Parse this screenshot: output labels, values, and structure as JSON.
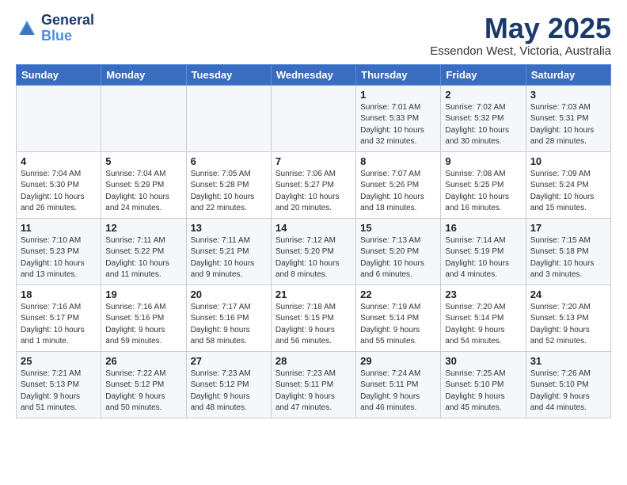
{
  "header": {
    "logo_general": "General",
    "logo_blue": "Blue",
    "month_title": "May 2025",
    "location": "Essendon West, Victoria, Australia"
  },
  "calendar": {
    "days_of_week": [
      "Sunday",
      "Monday",
      "Tuesday",
      "Wednesday",
      "Thursday",
      "Friday",
      "Saturday"
    ],
    "weeks": [
      [
        {
          "day": "",
          "info": ""
        },
        {
          "day": "",
          "info": ""
        },
        {
          "day": "",
          "info": ""
        },
        {
          "day": "",
          "info": ""
        },
        {
          "day": "1",
          "info": "Sunrise: 7:01 AM\nSunset: 5:33 PM\nDaylight: 10 hours\nand 32 minutes."
        },
        {
          "day": "2",
          "info": "Sunrise: 7:02 AM\nSunset: 5:32 PM\nDaylight: 10 hours\nand 30 minutes."
        },
        {
          "day": "3",
          "info": "Sunrise: 7:03 AM\nSunset: 5:31 PM\nDaylight: 10 hours\nand 28 minutes."
        }
      ],
      [
        {
          "day": "4",
          "info": "Sunrise: 7:04 AM\nSunset: 5:30 PM\nDaylight: 10 hours\nand 26 minutes."
        },
        {
          "day": "5",
          "info": "Sunrise: 7:04 AM\nSunset: 5:29 PM\nDaylight: 10 hours\nand 24 minutes."
        },
        {
          "day": "6",
          "info": "Sunrise: 7:05 AM\nSunset: 5:28 PM\nDaylight: 10 hours\nand 22 minutes."
        },
        {
          "day": "7",
          "info": "Sunrise: 7:06 AM\nSunset: 5:27 PM\nDaylight: 10 hours\nand 20 minutes."
        },
        {
          "day": "8",
          "info": "Sunrise: 7:07 AM\nSunset: 5:26 PM\nDaylight: 10 hours\nand 18 minutes."
        },
        {
          "day": "9",
          "info": "Sunrise: 7:08 AM\nSunset: 5:25 PM\nDaylight: 10 hours\nand 16 minutes."
        },
        {
          "day": "10",
          "info": "Sunrise: 7:09 AM\nSunset: 5:24 PM\nDaylight: 10 hours\nand 15 minutes."
        }
      ],
      [
        {
          "day": "11",
          "info": "Sunrise: 7:10 AM\nSunset: 5:23 PM\nDaylight: 10 hours\nand 13 minutes."
        },
        {
          "day": "12",
          "info": "Sunrise: 7:11 AM\nSunset: 5:22 PM\nDaylight: 10 hours\nand 11 minutes."
        },
        {
          "day": "13",
          "info": "Sunrise: 7:11 AM\nSunset: 5:21 PM\nDaylight: 10 hours\nand 9 minutes."
        },
        {
          "day": "14",
          "info": "Sunrise: 7:12 AM\nSunset: 5:20 PM\nDaylight: 10 hours\nand 8 minutes."
        },
        {
          "day": "15",
          "info": "Sunrise: 7:13 AM\nSunset: 5:20 PM\nDaylight: 10 hours\nand 6 minutes."
        },
        {
          "day": "16",
          "info": "Sunrise: 7:14 AM\nSunset: 5:19 PM\nDaylight: 10 hours\nand 4 minutes."
        },
        {
          "day": "17",
          "info": "Sunrise: 7:15 AM\nSunset: 5:18 PM\nDaylight: 10 hours\nand 3 minutes."
        }
      ],
      [
        {
          "day": "18",
          "info": "Sunrise: 7:16 AM\nSunset: 5:17 PM\nDaylight: 10 hours\nand 1 minute."
        },
        {
          "day": "19",
          "info": "Sunrise: 7:16 AM\nSunset: 5:16 PM\nDaylight: 9 hours\nand 59 minutes."
        },
        {
          "day": "20",
          "info": "Sunrise: 7:17 AM\nSunset: 5:16 PM\nDaylight: 9 hours\nand 58 minutes."
        },
        {
          "day": "21",
          "info": "Sunrise: 7:18 AM\nSunset: 5:15 PM\nDaylight: 9 hours\nand 56 minutes."
        },
        {
          "day": "22",
          "info": "Sunrise: 7:19 AM\nSunset: 5:14 PM\nDaylight: 9 hours\nand 55 minutes."
        },
        {
          "day": "23",
          "info": "Sunrise: 7:20 AM\nSunset: 5:14 PM\nDaylight: 9 hours\nand 54 minutes."
        },
        {
          "day": "24",
          "info": "Sunrise: 7:20 AM\nSunset: 5:13 PM\nDaylight: 9 hours\nand 52 minutes."
        }
      ],
      [
        {
          "day": "25",
          "info": "Sunrise: 7:21 AM\nSunset: 5:13 PM\nDaylight: 9 hours\nand 51 minutes."
        },
        {
          "day": "26",
          "info": "Sunrise: 7:22 AM\nSunset: 5:12 PM\nDaylight: 9 hours\nand 50 minutes."
        },
        {
          "day": "27",
          "info": "Sunrise: 7:23 AM\nSunset: 5:12 PM\nDaylight: 9 hours\nand 48 minutes."
        },
        {
          "day": "28",
          "info": "Sunrise: 7:23 AM\nSunset: 5:11 PM\nDaylight: 9 hours\nand 47 minutes."
        },
        {
          "day": "29",
          "info": "Sunrise: 7:24 AM\nSunset: 5:11 PM\nDaylight: 9 hours\nand 46 minutes."
        },
        {
          "day": "30",
          "info": "Sunrise: 7:25 AM\nSunset: 5:10 PM\nDaylight: 9 hours\nand 45 minutes."
        },
        {
          "day": "31",
          "info": "Sunrise: 7:26 AM\nSunset: 5:10 PM\nDaylight: 9 hours\nand 44 minutes."
        }
      ]
    ]
  }
}
